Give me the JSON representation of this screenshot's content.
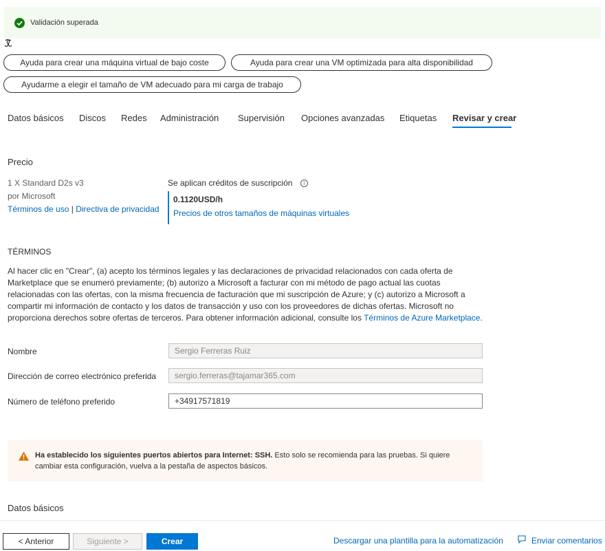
{
  "validation": {
    "text": "Validación superada",
    "icon": "check-circle-icon",
    "color": "#107c10"
  },
  "assist_buttons": [
    {
      "label": "Ayuda para crear una máquina virtual de bajo coste"
    },
    {
      "label": "Ayuda para crear una VM optimizada para alta disponibilidad"
    },
    {
      "label": "Ayudarme a elegir el tamaño de VM adecuado para mi carga de trabajo"
    }
  ],
  "tabs": [
    {
      "label": "Datos básicos"
    },
    {
      "label": "Discos"
    },
    {
      "label": "Redes"
    },
    {
      "label": "Administración"
    },
    {
      "label": "Supervisión"
    },
    {
      "label": "Opciones avanzadas"
    },
    {
      "label": "Etiquetas"
    },
    {
      "label": "Revisar y crear",
      "active": true
    }
  ],
  "price": {
    "title": "Precio",
    "product": "1 X Standard D2s v3",
    "publisher": "por Microsoft",
    "terms_link": "Términos de uso",
    "separator": "|",
    "privacy_link": "Directiva de privacidad",
    "credits_label": "Se aplican créditos de suscripción",
    "amount": "0.1120USD/h",
    "other_prices_link": "Precios de otros tamaños de máquinas virtuales"
  },
  "terms": {
    "title": "TÉRMINOS",
    "body": "Al hacer clic en \"Crear\", (a) acepto los términos legales y las declaraciones de privacidad relacionados con cada oferta de Marketplace que se enumeró previamente; (b) autorizo a Microsoft a facturar con mi método de pago actual las cuotas relacionadas con las ofertas, con la misma frecuencia de facturación que mi suscripción de Azure; y (c) autorizo a Microsoft a compartir mi información de contacto y los datos de transacción y uso con los proveedores de dichas ofertas. Microsoft no proporciona derechos sobre ofertas de terceros. Para obtener información adicional, consulte los ",
    "link": "Términos de Azure Marketplace",
    "end": "."
  },
  "form": {
    "name_label": "Nombre",
    "name_value": "Sergio Ferreras Ruiz",
    "email_label": "Dirección de correo electrónico preferida",
    "email_value": "sergio.ferreras@tajamar365.com",
    "phone_label": "Número de teléfono preferido",
    "phone_value": "+34917571819"
  },
  "warning": {
    "bold": "Ha establecido los siguientes puertos abiertos para Internet: SSH.",
    "text": "  Esto solo se recomienda para las pruebas.  Si quiere cambiar esta configuración, vuelva a la pestaña de aspectos básicos.",
    "icon": "warning-icon",
    "color": "#d47500"
  },
  "section_basics": "Datos básicos",
  "footer": {
    "prev": "< Anterior",
    "next": "Siguiente >",
    "create": "Crear",
    "download_link": "Descargar una plantilla para la automatización",
    "feedback_link": "Enviar comentarios"
  }
}
